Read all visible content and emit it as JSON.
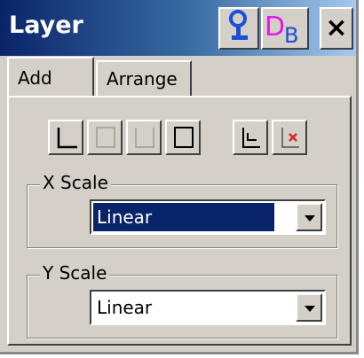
{
  "window": {
    "title": "Layer",
    "close_label": "×"
  },
  "tabs": [
    {
      "label": "Add",
      "active": true
    },
    {
      "label": "Arrange",
      "active": false
    }
  ],
  "axis_buttons": [
    {
      "icon": "bottom-left-axes-icon"
    },
    {
      "icon": "bottom-right-axes-icon"
    },
    {
      "icon": "top-right-axes-icon"
    },
    {
      "icon": "all-axes-box-icon"
    },
    {
      "icon": "linked-layer-icon"
    },
    {
      "icon": "remove-layer-icon"
    }
  ],
  "x_scale": {
    "label": "X Scale",
    "value": "Linear"
  },
  "y_scale": {
    "label": "Y Scale",
    "value": "Linear"
  },
  "colors": {
    "title_bar_start": "#0a246a",
    "title_bar_end": "#a6caf0",
    "face": "#d4d0c8",
    "selection": "#0a246a",
    "db_icon": "#e01ce0",
    "pin_icon": "#1a4fd8",
    "remove_mark": "#e02020"
  }
}
